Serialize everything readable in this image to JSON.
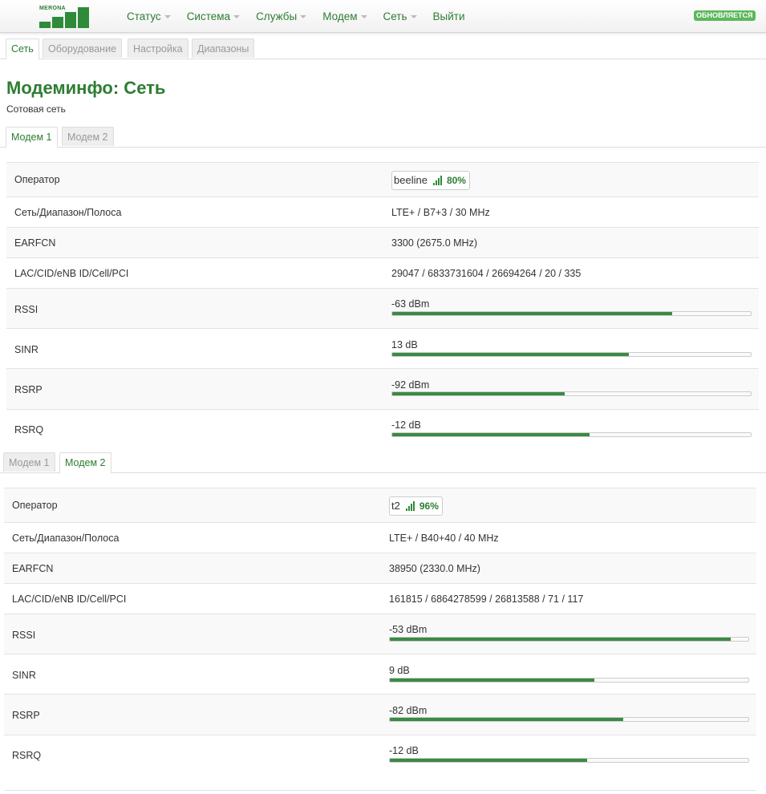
{
  "header": {
    "logo_text": "MERONA",
    "menu": [
      {
        "label": "Статус",
        "dropdown": true
      },
      {
        "label": "Система",
        "dropdown": true
      },
      {
        "label": "Службы",
        "dropdown": true
      },
      {
        "label": "Модем",
        "dropdown": true
      },
      {
        "label": "Сеть",
        "dropdown": true
      },
      {
        "label": "Выйти",
        "dropdown": false
      }
    ],
    "status_badge": "ОБНОВЛЯЕТСЯ"
  },
  "page_tabs": [
    {
      "label": "Сеть",
      "active": true
    },
    {
      "label": "Оборудование",
      "active": false
    },
    {
      "label": "Настройка",
      "active": false
    },
    {
      "label": "Диапазоны",
      "active": false
    }
  ],
  "page": {
    "title": "Модеминфо: Сеть",
    "subtitle": "Сотовая сеть"
  },
  "labels": {
    "operator": "Оператор",
    "network": "Сеть/Диапазон/Полоса",
    "earfcn": "EARFCN",
    "cell": "LAC/CID/eNB ID/Cell/PCI",
    "rssi": "RSSI",
    "sinr": "SINR",
    "rsrp": "RSRP",
    "rsrq": "RSRQ"
  },
  "modems": [
    {
      "tabs": [
        {
          "label": "Модем 1",
          "active": true
        },
        {
          "label": "Модем 2",
          "active": false
        }
      ],
      "operator": "beeline",
      "signal_percent": "80%",
      "network": "LTE+ / B7+3 / 30 MHz",
      "earfcn": "3300 (2675.0 MHz)",
      "cell": "29047 / 6833731604 / 26694264 / 20 / 335",
      "metrics": [
        {
          "key": "rssi",
          "value": "-63 dBm",
          "level": 0.78
        },
        {
          "key": "sinr",
          "value": "13 dB",
          "level": 0.66
        },
        {
          "key": "rsrp",
          "value": "-92 dBm",
          "level": 0.48
        },
        {
          "key": "rsrq",
          "value": "-12 dB",
          "level": 0.55
        }
      ]
    },
    {
      "tabs": [
        {
          "label": "Модем 1",
          "active": false
        },
        {
          "label": "Модем 2",
          "active": true
        }
      ],
      "operator": "t2",
      "signal_percent": "96%",
      "network": "LTE+ / B40+40 / 40 MHz",
      "earfcn": "38950 (2330.0 MHz)",
      "cell": "161815 / 6864278599 / 26813588 / 71 / 117",
      "metrics": [
        {
          "key": "rssi",
          "value": "-53 dBm",
          "level": 0.95
        },
        {
          "key": "sinr",
          "value": "9 dB",
          "level": 0.57
        },
        {
          "key": "rsrp",
          "value": "-82 dBm",
          "level": 0.65
        },
        {
          "key": "rsrq",
          "value": "-12 dB",
          "level": 0.55
        }
      ]
    }
  ],
  "colors": {
    "accent": "#2e7d32",
    "meter": "#3a8a44",
    "badge": "#5cb85c"
  }
}
